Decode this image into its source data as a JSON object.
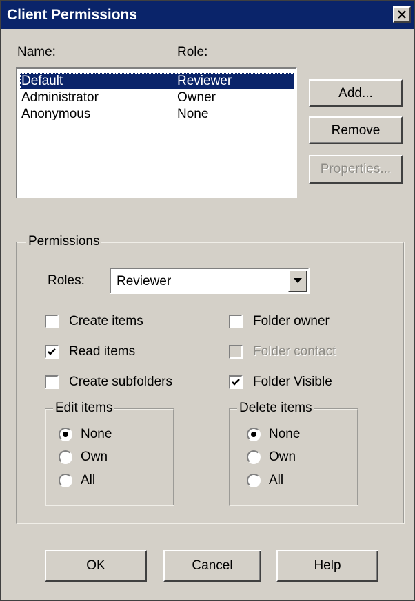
{
  "window": {
    "title": "Client Permissions"
  },
  "list": {
    "name_header": "Name:",
    "role_header": "Role:",
    "rows": [
      {
        "name": "Default",
        "role": "Reviewer",
        "selected": true
      },
      {
        "name": "Administrator",
        "role": "Owner",
        "selected": false
      },
      {
        "name": "Anonymous",
        "role": "None",
        "selected": false
      }
    ]
  },
  "side_buttons": {
    "add": "Add...",
    "remove": "Remove",
    "properties": "Properties..."
  },
  "permissions": {
    "group_label": "Permissions",
    "roles_label": "Roles:",
    "roles_value": "Reviewer",
    "checkboxes": {
      "create_items": {
        "label": "Create items",
        "checked": false,
        "enabled": true
      },
      "read_items": {
        "label": "Read items",
        "checked": true,
        "enabled": true
      },
      "create_subfolders": {
        "label": "Create subfolders",
        "checked": false,
        "enabled": true
      },
      "folder_owner": {
        "label": "Folder owner",
        "checked": false,
        "enabled": true
      },
      "folder_contact": {
        "label": "Folder contact",
        "checked": false,
        "enabled": false
      },
      "folder_visible": {
        "label": "Folder Visible",
        "checked": true,
        "enabled": true
      }
    },
    "edit_items": {
      "label": "Edit items",
      "options": [
        "None",
        "Own",
        "All"
      ],
      "selected": "None"
    },
    "delete_items": {
      "label": "Delete items",
      "options": [
        "None",
        "Own",
        "All"
      ],
      "selected": "None"
    }
  },
  "footer": {
    "ok": "OK",
    "cancel": "Cancel",
    "help": "Help"
  },
  "colors": {
    "titlebar": "#0a246a",
    "face": "#d4d0c8",
    "selection": "#0a246a"
  },
  "icons": {
    "close": "close-icon",
    "dropdown": "chevron-down-icon",
    "check": "checkmark-icon"
  }
}
